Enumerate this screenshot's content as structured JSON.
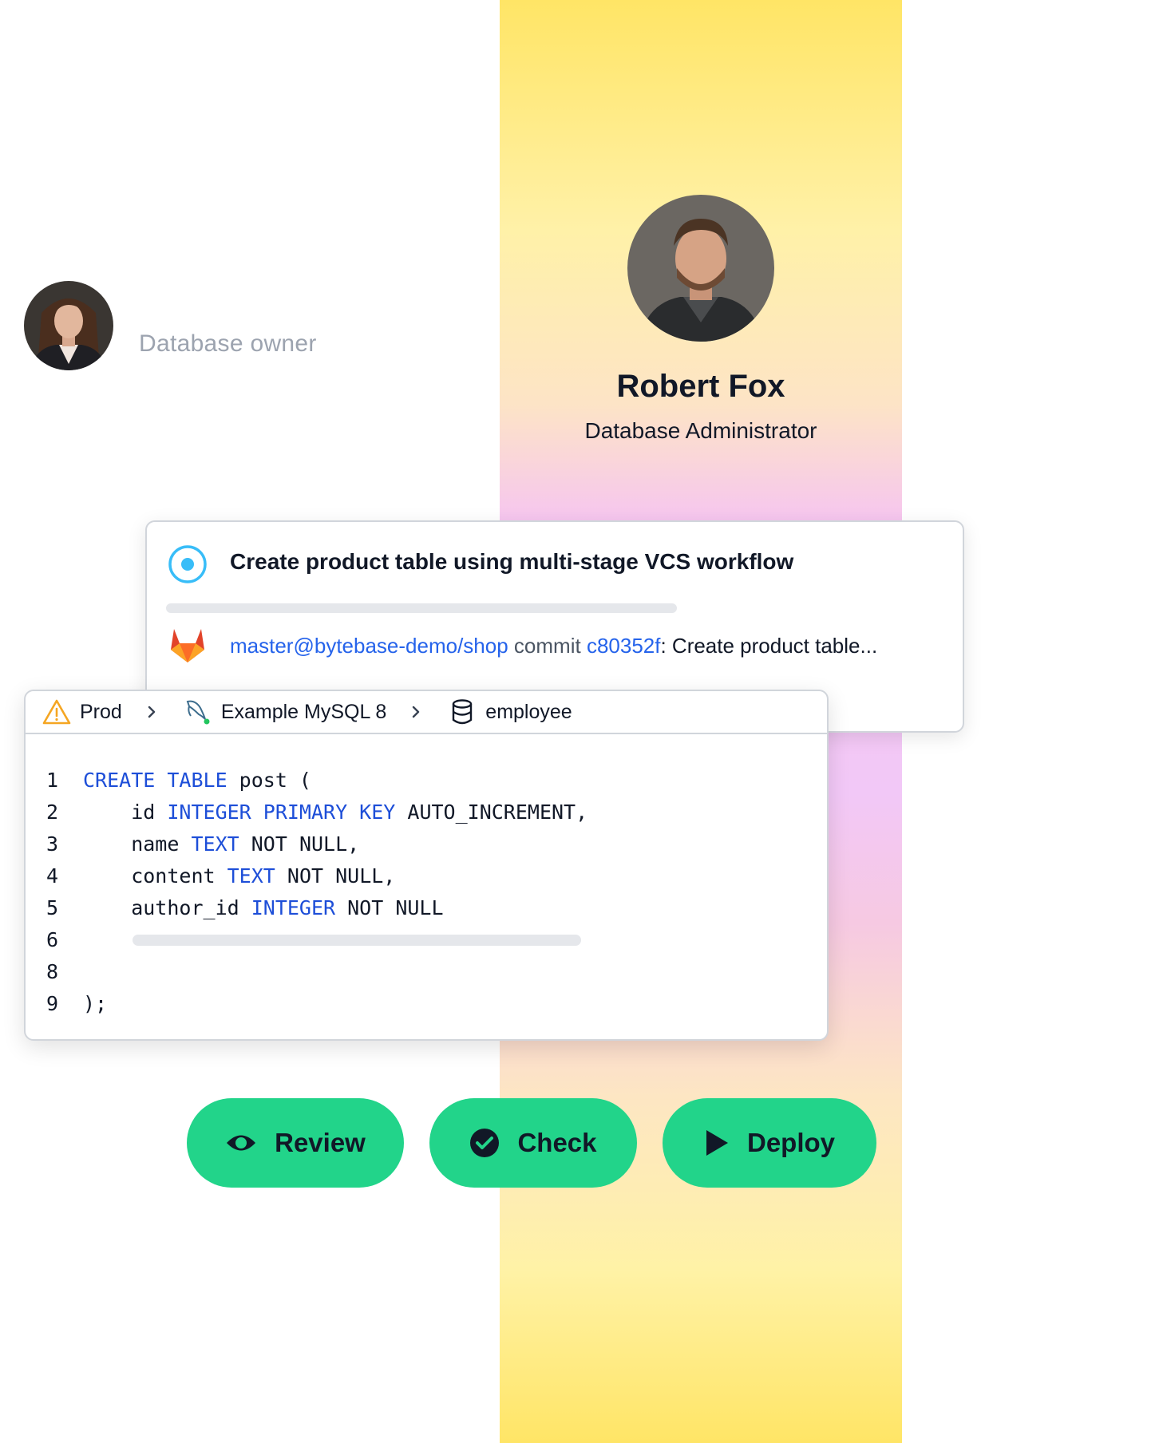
{
  "owner": {
    "role": "Database owner"
  },
  "admin": {
    "name": "Robert Fox",
    "role": "Database Administrator"
  },
  "issue": {
    "title": "Create product table using multi-stage VCS workflow",
    "repo_ref": "master@bytebase-demo/shop",
    "commit_word": "commit",
    "commit_hash": "c80352f",
    "commit_message": ": Create product table..."
  },
  "breadcrumb": {
    "environment": "Prod",
    "instance": "Example MySQL 8",
    "database": "employee"
  },
  "code": {
    "lines": [
      {
        "n": "1",
        "tokens": [
          {
            "t": "CREATE TABLE",
            "kw": true
          },
          {
            "t": " post (",
            "kw": false
          }
        ]
      },
      {
        "n": "2",
        "tokens": [
          {
            "t": "    id ",
            "kw": false
          },
          {
            "t": "INTEGER PRIMARY KEY",
            "kw": true
          },
          {
            "t": " AUTO_INCREMENT,",
            "kw": false
          }
        ]
      },
      {
        "n": "3",
        "tokens": [
          {
            "t": "    name ",
            "kw": false
          },
          {
            "t": "TEXT",
            "kw": true
          },
          {
            "t": " NOT NULL,",
            "kw": false
          }
        ]
      },
      {
        "n": "4",
        "tokens": [
          {
            "t": "    content ",
            "kw": false
          },
          {
            "t": "TEXT",
            "kw": true
          },
          {
            "t": " NOT NULL,",
            "kw": false
          }
        ]
      },
      {
        "n": "5",
        "tokens": [
          {
            "t": "    author_id ",
            "kw": false
          },
          {
            "t": "INTEGER",
            "kw": true
          },
          {
            "t": " NOT NULL",
            "kw": false
          }
        ]
      },
      {
        "n": "6",
        "tokens": []
      },
      {
        "n": "8",
        "tokens": []
      },
      {
        "n": "9",
        "tokens": [
          {
            "t": ");",
            "kw": false
          }
        ]
      }
    ]
  },
  "actions": {
    "review_label": "Review",
    "check_label": "Check",
    "deploy_label": "Deploy"
  },
  "colors": {
    "accent_green": "#22d48a",
    "link_blue": "#2563eb",
    "keyword_blue": "#1d4ed8",
    "status_blue": "#38bdf8"
  },
  "icons": {
    "status": "in-progress-circle-icon",
    "vcs": "gitlab-icon",
    "environment": "warning-triangle-icon",
    "instance": "mysql-dolphin-icon",
    "database": "database-cylinder-icon",
    "review": "eye-icon",
    "check": "check-circle-icon",
    "deploy": "play-icon"
  }
}
